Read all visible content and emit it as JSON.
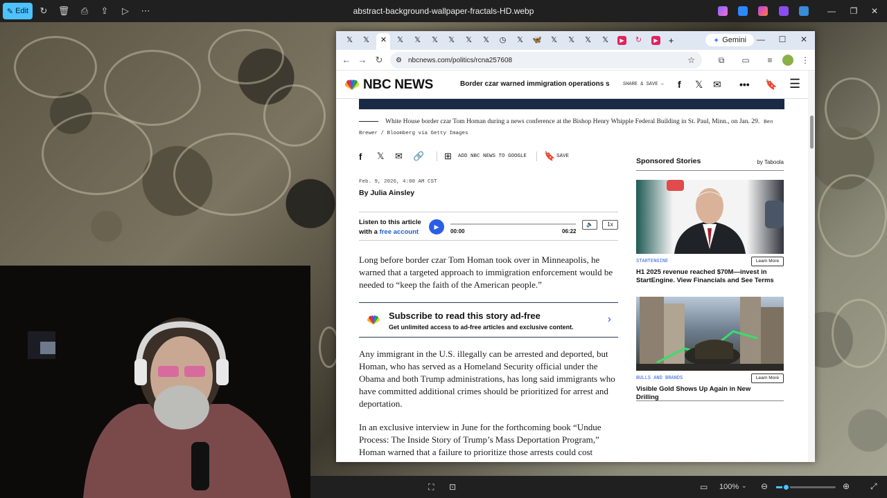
{
  "photos": {
    "edit_label": "Edit",
    "file_title": "abstract-background-wallpaper-fractals-HD.webp",
    "zoom": "100%"
  },
  "browser": {
    "gemini_label": "Gemini",
    "url": "nbcnews.com/politics/rcna257608"
  },
  "nbc": {
    "logo_text": "NBC NEWS",
    "header_title": "Border czar warned immigration operations should",
    "share_save": "SHARE & SAVE —",
    "caption": "White House border czar Tom Homan during a news conference at the Bishop Henry Whipple Federal Building in St. Paul, Minn., on Jan. 29.",
    "credit": "Ben Brewer / Bloomberg via Getty Images",
    "add_google": "ADD NBC NEWS TO GOOGLE",
    "save_label": "SAVE",
    "dateline": "Feb. 9, 2026, 4:00 AM CST",
    "byline": "By Julia Ainsley",
    "listen_line1": "Listen to this article",
    "listen_line2_prefix": "with a ",
    "listen_link": "free account",
    "time_start": "00:00",
    "time_end": "06:22",
    "speed": "1x",
    "para1": "Long before border czar Tom Homan took over in Minneapolis, he warned that a targeted approach to immigration enforcement would be needed to “keep the faith of the American people.”",
    "subscribe_title": "Subscribe to read this story ad-free",
    "subscribe_text": "Get unlimited access to ad-free articles and exclusive content.",
    "para2": "Any immigrant in the U.S. illegally can be arrested and deported, but Homan, who has served as a Homeland Security official under the Obama and both Trump administrations, has long said immigrants who have committed additional crimes should be prioritized for arrest and deportation.",
    "para3": "In an exclusive interview in June for the forthcoming book “Undue Process: The Inside Story of Trump’s Mass Deportation Program,” Homan warned that a failure to prioritize those arrests could cost"
  },
  "sponsored": {
    "title": "Sponsored Stories",
    "by": "by Taboola",
    "items": [
      {
        "category": "STARTENGINE",
        "button": "Learn More",
        "text": "H1 2025 revenue reached $70M—invest in StartEngine. View Financials and See Terms"
      },
      {
        "category": "BULLS AND BRANDS",
        "button": "Learn More",
        "text": "Visible Gold Shows Up Again in New Drilling"
      }
    ]
  },
  "colors": {
    "accent_blue": "#2b5ee8",
    "photos_edit": "#4cc2ff",
    "photos_bar": "#202020"
  }
}
